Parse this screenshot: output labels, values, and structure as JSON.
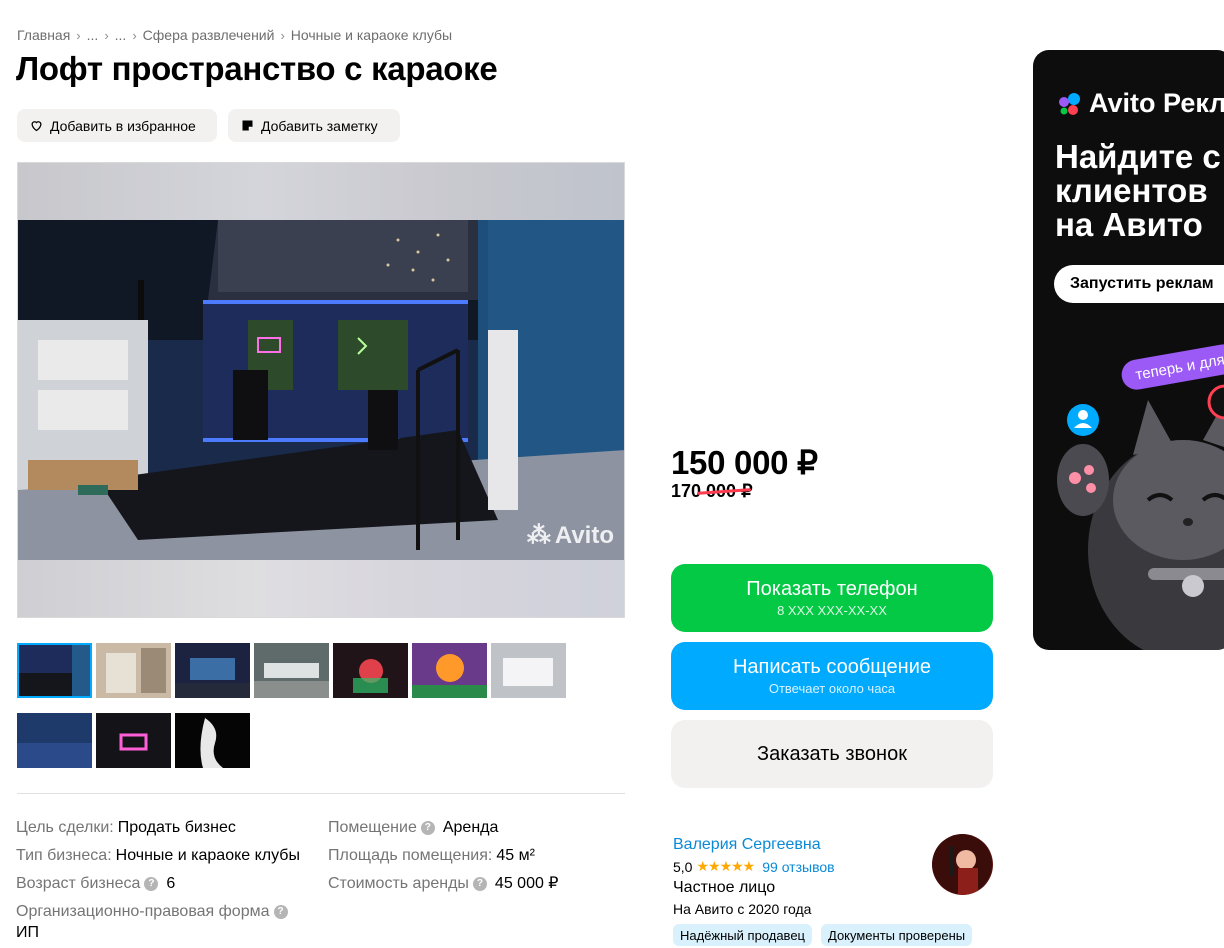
{
  "breadcrumb": {
    "items": [
      "Главная",
      "...",
      "...",
      "Сфера развлечений",
      "Ночные и караоке клубы"
    ]
  },
  "listing": {
    "title": "Лофт пространство с караоке",
    "favorite_label": "Добавить в избранное",
    "note_label": "Добавить заметку"
  },
  "gallery": {
    "watermark": "Avito",
    "thumb_count": 10,
    "active_index": 0
  },
  "params": {
    "left": [
      {
        "key": "Цель сделки:",
        "value": "Продать бизнес"
      },
      {
        "key": "Тип бизнеса:",
        "value": "Ночные и караоке клубы"
      },
      {
        "key": "Возраст бизнеса",
        "value": "6"
      },
      {
        "key": "Организационно-правовая форма",
        "value": "ИП"
      }
    ],
    "right": [
      {
        "key": "Помещение",
        "value": "Аренда"
      },
      {
        "key": "Площадь помещения:",
        "value": "45 м²"
      },
      {
        "key": "Стоимость аренды",
        "value": "45 000 ₽"
      }
    ]
  },
  "pricing": {
    "price": "150 000 ₽",
    "old_price": "170 000 ₽"
  },
  "actions": {
    "phone_label": "Показать телефон",
    "phone_masked": "8 XXX XXX-XX-XX",
    "message_label": "Написать сообщение",
    "message_sub": "Отвечает около часа",
    "callback_label": "Заказать звонок"
  },
  "seller": {
    "name": "Валерия Сергеевна",
    "rating": "5,0",
    "stars": "★★★★★",
    "reviews": "99 отзывов",
    "type": "Частное лицо",
    "since": "На Авито с 2020 года",
    "badges": [
      "Надёжный продавец",
      "Документы проверены"
    ]
  },
  "ad": {
    "logo": "Avito Рекла",
    "headline_1": "Найдите с",
    "headline_2": "клиентов",
    "headline_3": "на Авито",
    "cta": "Запустить реклам",
    "tag": "теперь и для"
  },
  "colors": {
    "green": "#04c945",
    "blue": "#00aaff",
    "link": "#0a8ad6",
    "star": "#ffa800",
    "strike": "#ff3b4f"
  }
}
